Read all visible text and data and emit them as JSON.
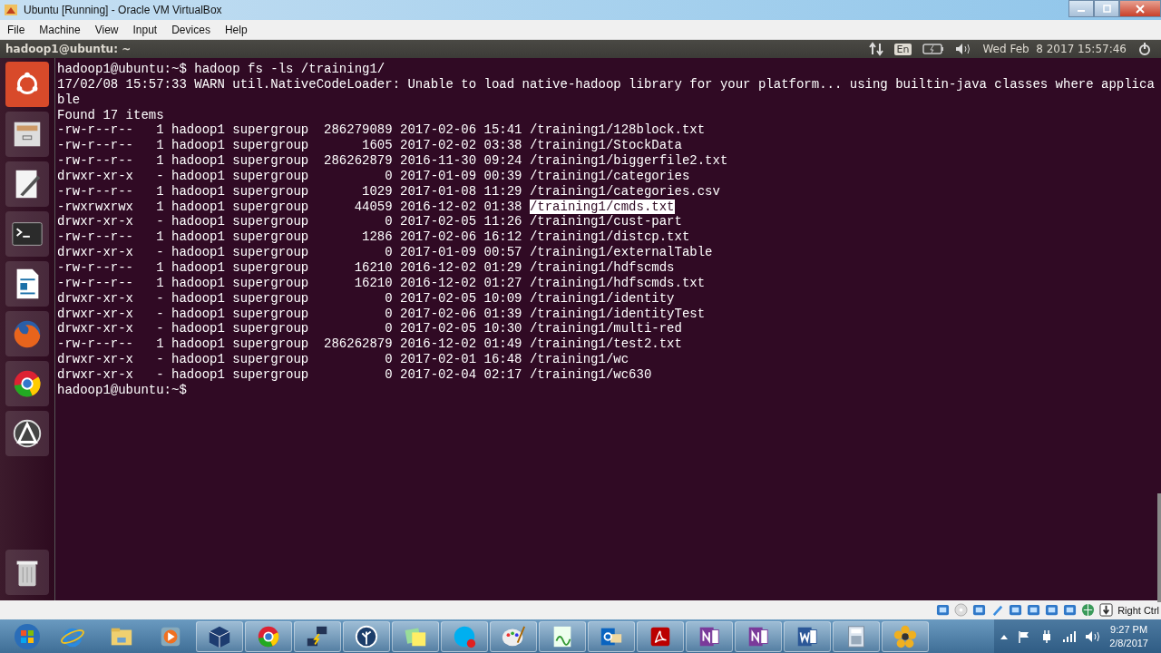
{
  "window": {
    "title": "Ubuntu [Running] - Oracle VM VirtualBox"
  },
  "menu": [
    "File",
    "Machine",
    "View",
    "Input",
    "Devices",
    "Help"
  ],
  "panel": {
    "title": "hadoop1@ubuntu: ~",
    "keyboard": "En",
    "clock": "Wed Feb  8 2017 15:57:46"
  },
  "terminal": {
    "lines": [
      {
        "kind": "text",
        "text": "hadoop1@ubuntu:~$ hadoop fs -ls /training1/"
      },
      {
        "kind": "text",
        "text": "17/02/08 15:57:33 WARN util.NativeCodeLoader: Unable to load native-hadoop library for your platform... using builtin-java classes where applica"
      },
      {
        "kind": "text",
        "text": "ble"
      },
      {
        "kind": "text",
        "text": "Found 17 items"
      },
      {
        "kind": "file",
        "perms": "-rw-r--r--",
        "replicas": "1",
        "owner": "hadoop1",
        "group": "supergroup",
        "size": "286279089",
        "date": "2017-02-06",
        "time": "15:41",
        "path": "/training1/128block.txt",
        "selected": false
      },
      {
        "kind": "file",
        "perms": "-rw-r--r--",
        "replicas": "1",
        "owner": "hadoop1",
        "group": "supergroup",
        "size": "1605",
        "date": "2017-02-02",
        "time": "03:38",
        "path": "/training1/StockData",
        "selected": false
      },
      {
        "kind": "file",
        "perms": "-rw-r--r--",
        "replicas": "1",
        "owner": "hadoop1",
        "group": "supergroup",
        "size": "286262879",
        "date": "2016-11-30",
        "time": "09:24",
        "path": "/training1/biggerfile2.txt",
        "selected": false
      },
      {
        "kind": "file",
        "perms": "drwxr-xr-x",
        "replicas": "-",
        "owner": "hadoop1",
        "group": "supergroup",
        "size": "0",
        "date": "2017-01-09",
        "time": "00:39",
        "path": "/training1/categories",
        "selected": false
      },
      {
        "kind": "file",
        "perms": "-rw-r--r--",
        "replicas": "1",
        "owner": "hadoop1",
        "group": "supergroup",
        "size": "1029",
        "date": "2017-01-08",
        "time": "11:29",
        "path": "/training1/categories.csv",
        "selected": false
      },
      {
        "kind": "file",
        "perms": "-rwxrwxrwx",
        "replicas": "1",
        "owner": "hadoop1",
        "group": "supergroup",
        "size": "44059",
        "date": "2016-12-02",
        "time": "01:38",
        "path": "/training1/cmds.txt",
        "selected": true
      },
      {
        "kind": "file",
        "perms": "drwxr-xr-x",
        "replicas": "-",
        "owner": "hadoop1",
        "group": "supergroup",
        "size": "0",
        "date": "2017-02-05",
        "time": "11:26",
        "path": "/training1/cust-part",
        "selected": false
      },
      {
        "kind": "file",
        "perms": "-rw-r--r--",
        "replicas": "1",
        "owner": "hadoop1",
        "group": "supergroup",
        "size": "1286",
        "date": "2017-02-06",
        "time": "16:12",
        "path": "/training1/distcp.txt",
        "selected": false
      },
      {
        "kind": "file",
        "perms": "drwxr-xr-x",
        "replicas": "-",
        "owner": "hadoop1",
        "group": "supergroup",
        "size": "0",
        "date": "2017-01-09",
        "time": "00:57",
        "path": "/training1/externalTable",
        "selected": false
      },
      {
        "kind": "file",
        "perms": "-rw-r--r--",
        "replicas": "1",
        "owner": "hadoop1",
        "group": "supergroup",
        "size": "16210",
        "date": "2016-12-02",
        "time": "01:29",
        "path": "/training1/hdfscmds",
        "selected": false
      },
      {
        "kind": "file",
        "perms": "-rw-r--r--",
        "replicas": "1",
        "owner": "hadoop1",
        "group": "supergroup",
        "size": "16210",
        "date": "2016-12-02",
        "time": "01:27",
        "path": "/training1/hdfscmds.txt",
        "selected": false
      },
      {
        "kind": "file",
        "perms": "drwxr-xr-x",
        "replicas": "-",
        "owner": "hadoop1",
        "group": "supergroup",
        "size": "0",
        "date": "2017-02-05",
        "time": "10:09",
        "path": "/training1/identity",
        "selected": false
      },
      {
        "kind": "file",
        "perms": "drwxr-xr-x",
        "replicas": "-",
        "owner": "hadoop1",
        "group": "supergroup",
        "size": "0",
        "date": "2017-02-06",
        "time": "01:39",
        "path": "/training1/identityTest",
        "selected": false
      },
      {
        "kind": "file",
        "perms": "drwxr-xr-x",
        "replicas": "-",
        "owner": "hadoop1",
        "group": "supergroup",
        "size": "0",
        "date": "2017-02-05",
        "time": "10:30",
        "path": "/training1/multi-red",
        "selected": false
      },
      {
        "kind": "file",
        "perms": "-rw-r--r--",
        "replicas": "1",
        "owner": "hadoop1",
        "group": "supergroup",
        "size": "286262879",
        "date": "2016-12-02",
        "time": "01:49",
        "path": "/training1/test2.txt",
        "selected": false
      },
      {
        "kind": "file",
        "perms": "drwxr-xr-x",
        "replicas": "-",
        "owner": "hadoop1",
        "group": "supergroup",
        "size": "0",
        "date": "2017-02-01",
        "time": "16:48",
        "path": "/training1/wc",
        "selected": false
      },
      {
        "kind": "file",
        "perms": "drwxr-xr-x",
        "replicas": "-",
        "owner": "hadoop1",
        "group": "supergroup",
        "size": "0",
        "date": "2017-02-04",
        "time": "02:17",
        "path": "/training1/wc630",
        "selected": false
      },
      {
        "kind": "text",
        "text": "hadoop1@ubuntu:~$"
      }
    ]
  },
  "vm_status": {
    "host_key": "Right Ctrl"
  },
  "tray": {
    "time": "9:27 PM",
    "date": "2/8/2017"
  }
}
